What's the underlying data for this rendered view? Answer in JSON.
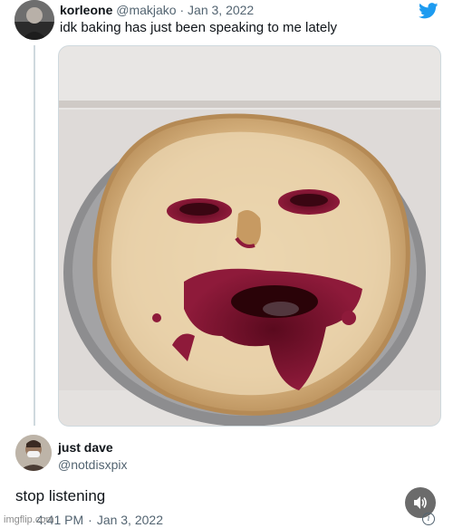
{
  "tweet1": {
    "name": "korleone",
    "handle": "@makjako",
    "separator": "·",
    "date": "Jan 3, 2022",
    "text": "idk baking has just been speaking to me lately",
    "icon": "twitter-bird-icon",
    "accent": "#1d9bf0"
  },
  "tweet2": {
    "name": "just dave",
    "handle": "@notdisxpix",
    "text": "stop listening",
    "time": "4:41 PM",
    "separator": "·",
    "date": "Jan 3, 2022"
  },
  "watermark": "imgflip.com",
  "controls": {
    "sound_icon": "speaker-icon",
    "info_icon": "info-icon",
    "info_glyph": "i"
  }
}
